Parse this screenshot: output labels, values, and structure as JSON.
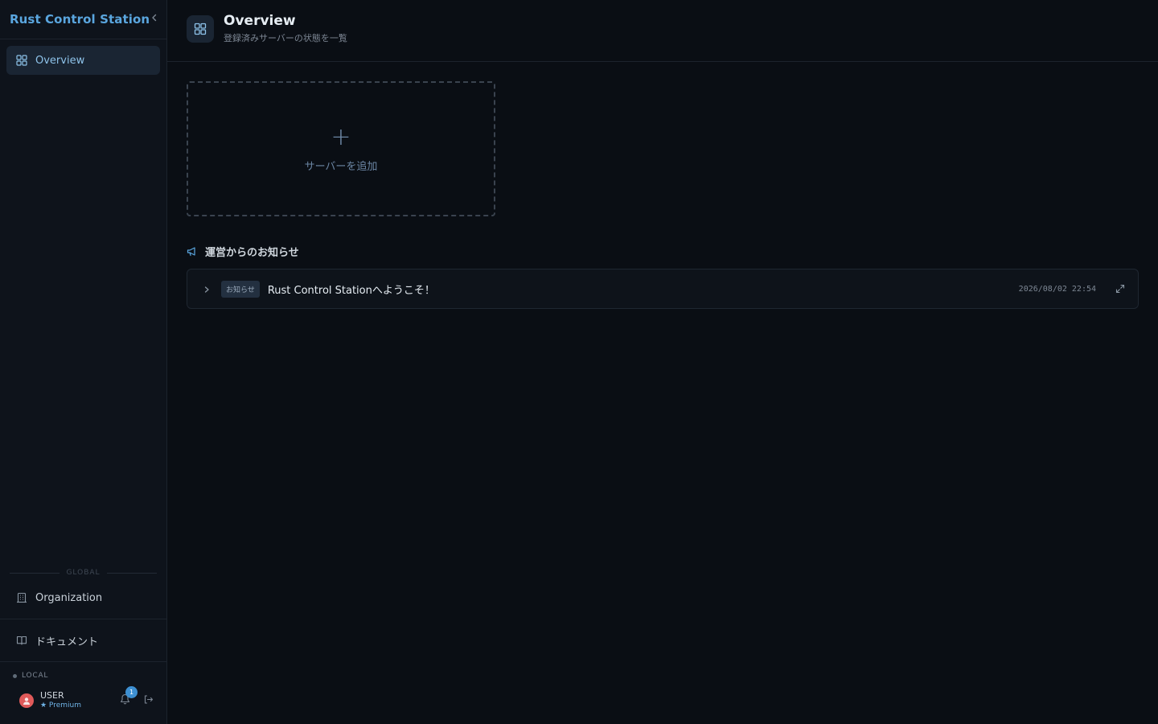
{
  "sidebar": {
    "brand": "Rust Control Station",
    "nav": [
      {
        "label": "Overview",
        "active": true
      }
    ],
    "global_label": "GLOBAL",
    "organization_label": "Organization",
    "docs_label": "ドキュメント",
    "env_label": "LOCAL",
    "user": {
      "name": "USER",
      "plan": "★ Premium"
    },
    "notifications_count": "1"
  },
  "header": {
    "title": "Overview",
    "subtitle": "登録済みサーバーの状態を一覧"
  },
  "add_server": {
    "label": "サーバーを追加",
    "plus": "+"
  },
  "announcements": {
    "heading": "運営からのお知らせ",
    "items": [
      {
        "badge": "お知らせ",
        "title": "Rust Control Stationへようこそ！",
        "date": "2026/08/02 22:54"
      }
    ]
  },
  "colors": {
    "accent": "#5aa6df",
    "background": "#0a0e14",
    "sidebar": "#0e131b"
  }
}
